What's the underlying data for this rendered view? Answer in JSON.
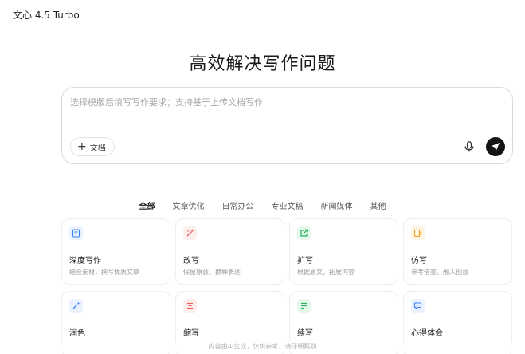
{
  "header": {
    "model_name": "文心 4.5 Turbo"
  },
  "hero": {
    "title": "高效解决写作问题"
  },
  "input": {
    "placeholder": "选择模版后填写写作要求；支持基于上传文档写作",
    "doc_button_label": "文档",
    "plus_glyph": "+"
  },
  "tabs": [
    {
      "label": "全部",
      "active": true
    },
    {
      "label": "文章优化",
      "active": false
    },
    {
      "label": "日常办公",
      "active": false
    },
    {
      "label": "专业文稿",
      "active": false
    },
    {
      "label": "新闻媒体",
      "active": false
    },
    {
      "label": "其他",
      "active": false
    }
  ],
  "cards": [
    {
      "title": "深度写作",
      "desc": "结合素材，撰写优质文章",
      "icon": "doc-edit-icon",
      "color": "#3b82f6",
      "bg": "#eaf2ff"
    },
    {
      "title": "改写",
      "desc": "保留原意，换种表达",
      "icon": "magic-wand-icon",
      "color": "#ef5a5a",
      "bg": "#fdeeee"
    },
    {
      "title": "扩写",
      "desc": "根据原文，拓展内容",
      "icon": "expand-icon",
      "color": "#22b15a",
      "bg": "#e6f7ec"
    },
    {
      "title": "仿写",
      "desc": "参考借鉴，融入创意",
      "icon": "copy-edit-icon",
      "color": "#f0a020",
      "bg": "#fdf4e3"
    },
    {
      "title": "润色",
      "desc": "",
      "icon": "polish-wand-icon",
      "color": "#3b82f6",
      "bg": "#eaf2ff"
    },
    {
      "title": "缩写",
      "desc": "",
      "icon": "shrink-lines-icon",
      "color": "#ef5a5a",
      "bg": "#fdeeee"
    },
    {
      "title": "续写",
      "desc": "",
      "icon": "continue-lines-icon",
      "color": "#22b15a",
      "bg": "#e6f7ec"
    },
    {
      "title": "心得体会",
      "desc": "",
      "icon": "chat-bubble-icon",
      "color": "#3b82f6",
      "bg": "#eaf2ff"
    }
  ],
  "footer": {
    "disclaimer": "内容由AI生成，仅供参考，请仔细甄别"
  }
}
